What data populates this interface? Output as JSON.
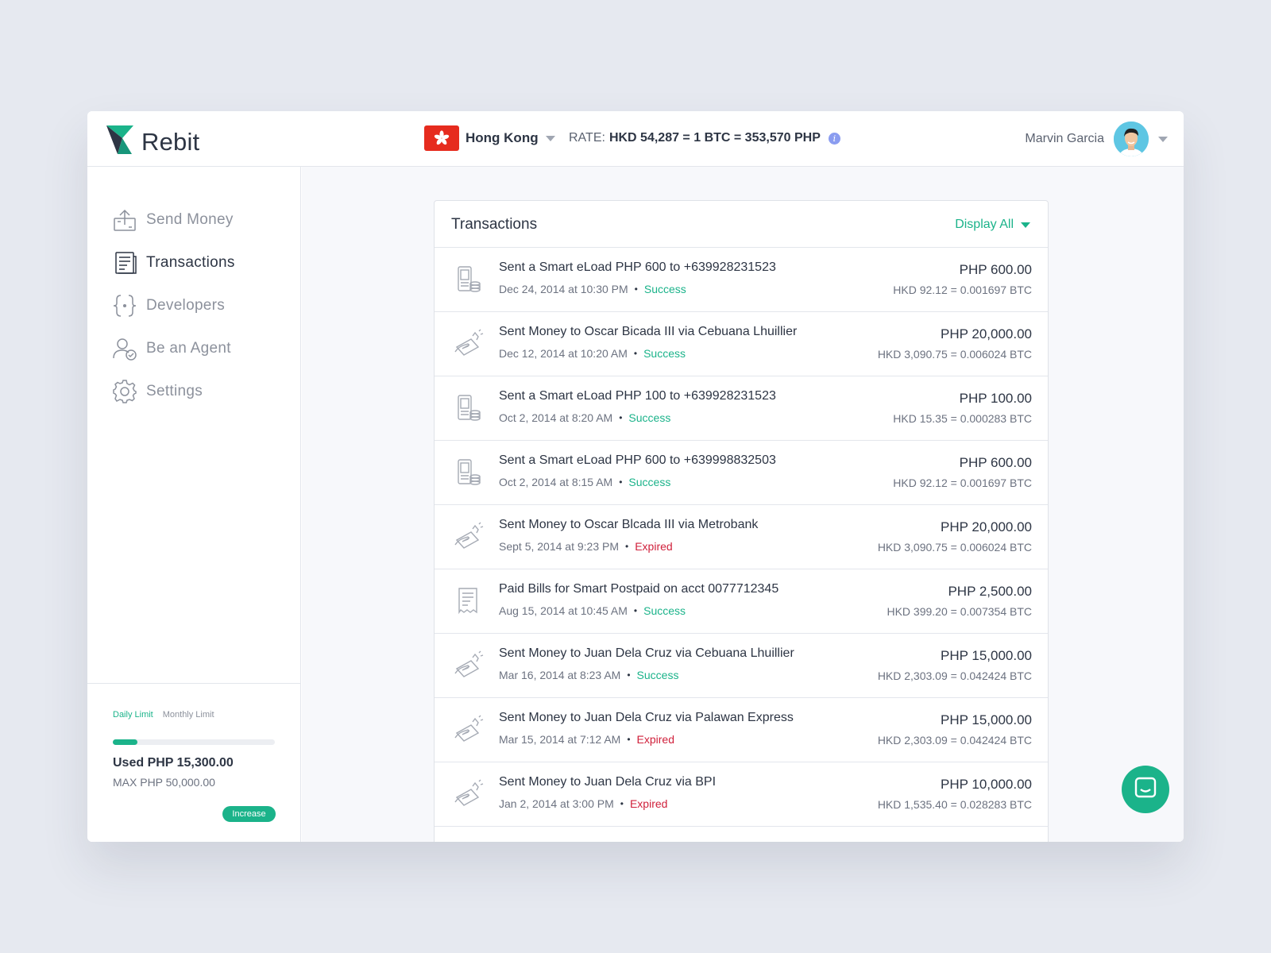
{
  "app": {
    "name": "Rebit"
  },
  "header": {
    "country": "Hong Kong",
    "rate_label": "RATE:",
    "rate_value": "HKD 54,287 = 1 BTC = 353,570 PHP",
    "info_icon": "info-icon",
    "user_name": "Marvin Garcia"
  },
  "sidebar": {
    "items": [
      {
        "label": "Send Money",
        "icon": "send-money-icon",
        "active": false
      },
      {
        "label": "Transactions",
        "icon": "transactions-icon",
        "active": true
      },
      {
        "label": "Developers",
        "icon": "developers-icon",
        "active": false
      },
      {
        "label": "Be an Agent",
        "icon": "agent-icon",
        "active": false
      },
      {
        "label": "Settings",
        "icon": "gear-icon",
        "active": false
      }
    ],
    "limits": {
      "tabs": [
        "Daily Limit",
        "Monthly Limit"
      ],
      "active_tab": "Daily Limit",
      "used": "Used PHP 15,300.00",
      "max": "MAX  PHP 50,000.00",
      "progress_fraction": 0.15,
      "increase_label": "Increase"
    }
  },
  "transactions": {
    "title": "Transactions",
    "filter_label": "Display All",
    "rows": [
      {
        "icon": "phone-load-icon",
        "title": "Sent a Smart eLoad PHP 600 to +639928231523",
        "date": "Dec 24, 2014 at 10:30 PM",
        "status": "Success",
        "amount": "PHP 600.00",
        "conversion": "HKD 92.12 = 0.001697 BTC"
      },
      {
        "icon": "send-money-icon",
        "title": "Sent Money to Oscar Bicada III via Cebuana Lhuillier",
        "date": "Dec 12, 2014 at 10:20 AM",
        "status": "Success",
        "amount": "PHP 20,000.00",
        "conversion": "HKD 3,090.75 = 0.006024 BTC"
      },
      {
        "icon": "phone-load-icon",
        "title": "Sent a Smart eLoad PHP 100 to +639928231523",
        "date": "Oct 2, 2014 at 8:20 AM",
        "status": "Success",
        "amount": "PHP 100.00",
        "conversion": "HKD 15.35 = 0.000283 BTC"
      },
      {
        "icon": "phone-load-icon",
        "title": "Sent a Smart eLoad PHP 600 to +639998832503",
        "date": "Oct 2, 2014 at 8:15 AM",
        "status": "Success",
        "amount": "PHP 600.00",
        "conversion": "HKD 92.12 = 0.001697 BTC"
      },
      {
        "icon": "send-money-icon",
        "title": "Sent Money to Oscar Blcada III via Metrobank",
        "date": "Sept 5, 2014 at 9:23 PM",
        "status": "Expired",
        "amount": "PHP 20,000.00",
        "conversion": "HKD 3,090.75 = 0.006024 BTC"
      },
      {
        "icon": "bill-icon",
        "title": "Paid Bills for Smart Postpaid on acct 0077712345",
        "date": "Aug 15, 2014 at 10:45 AM",
        "status": "Success",
        "amount": "PHP 2,500.00",
        "conversion": "HKD 399.20 = 0.007354 BTC"
      },
      {
        "icon": "send-money-icon",
        "title": "Sent Money to Juan Dela Cruz via Cebuana Lhuillier",
        "date": "Mar 16, 2014 at 8:23 AM",
        "status": "Success",
        "amount": "PHP 15,000.00",
        "conversion": "HKD 2,303.09 = 0.042424 BTC"
      },
      {
        "icon": "send-money-icon",
        "title": "Sent Money to Juan Dela Cruz via Palawan Express",
        "date": "Mar 15, 2014 at 7:12 AM",
        "status": "Expired",
        "amount": "PHP 15,000.00",
        "conversion": "HKD 2,303.09 = 0.042424 BTC"
      },
      {
        "icon": "send-money-icon",
        "title": "Sent Money to Juan Dela Cruz via BPI",
        "date": "Jan 2, 2014 at 3:00 PM",
        "status": "Expired",
        "amount": "PHP 10,000.00",
        "conversion": "HKD 1,535.40 = 0.028283 BTC"
      }
    ]
  },
  "chat": {
    "icon": "chat-icon"
  },
  "colors": {
    "accent": "#1bb38a",
    "expired": "#d0203b",
    "flag": "#e62b1e"
  }
}
